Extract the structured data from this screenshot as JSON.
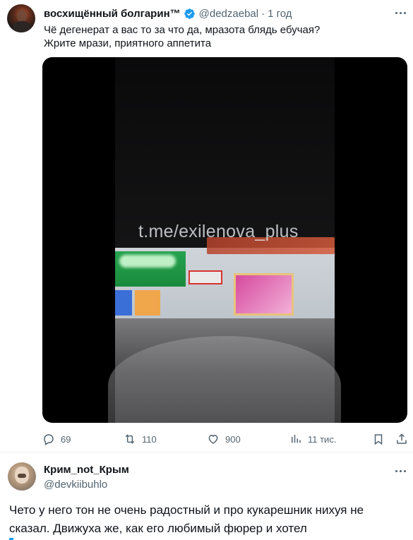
{
  "tweet": {
    "author_name": "восхищённый болгарин™",
    "handle": "@dedzaebal",
    "separator": "·",
    "time": "1 год",
    "text_lines": [
      "Чё дегенерат а вас то за что да, мразота блядь ебучая?",
      "Жрите мрази, приятного аппетита"
    ],
    "video_watermark": "t.me/exilenova_plus",
    "stats": {
      "replies": "69",
      "retweets": "110",
      "likes": "900",
      "views": "11 тис."
    }
  },
  "reply": {
    "author_name": "Крим_not_Крым",
    "handle": "@devkiibuhlo",
    "text_lines": [
      "Чето у него тон не очень радостный и про кукарешник нихуя не",
      "сказал. Движуха же, как его любимый фюрер и хотел"
    ]
  },
  "colors": {
    "verified": "#1d9bf0",
    "secondary_text": "#536471",
    "primary_text": "#0f1419"
  }
}
